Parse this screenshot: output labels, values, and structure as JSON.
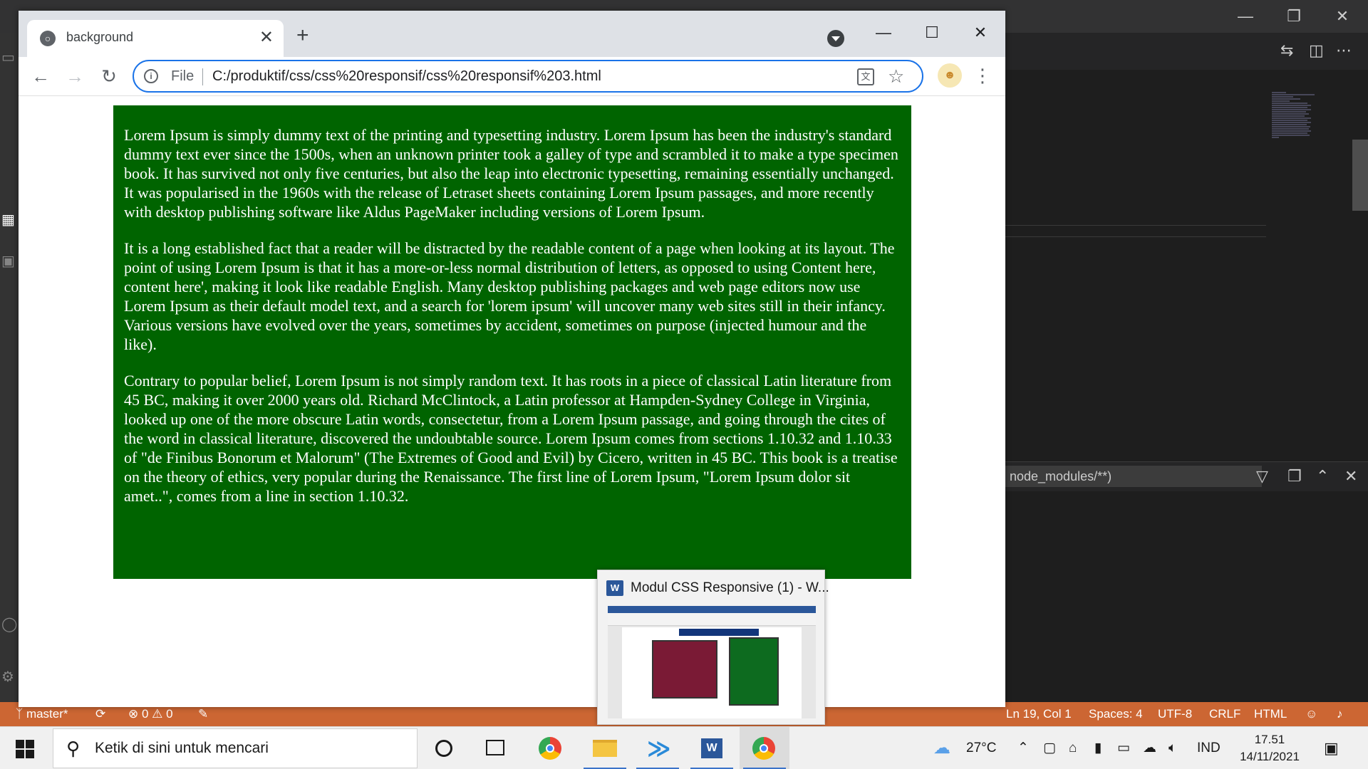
{
  "vscode": {
    "filter_text": "node_modules/**)",
    "status": {
      "branch": "master*",
      "errors": "0",
      "warnings": "0",
      "cursor": "Ln 19, Col 1",
      "spaces": "Spaces: 4",
      "encoding": "UTF-8",
      "eol": "CRLF",
      "language": "HTML"
    }
  },
  "chrome": {
    "tab_title": "background",
    "scheme_label": "File",
    "url": "C:/produktif/css/css%20responsif/css%20responsif%203.html"
  },
  "page": {
    "paragraphs": [
      "Lorem Ipsum is simply dummy text of the printing and typesetting industry. Lorem Ipsum has been the industry's standard dummy text ever since the 1500s, when an unknown printer took a galley of type and scrambled it to make a type specimen book. It has survived not only five centuries, but also the leap into electronic typesetting, remaining essentially unchanged. It was popularised in the 1960s with the release of Letraset sheets containing Lorem Ipsum passages, and more recently with desktop publishing software like Aldus PageMaker including versions of Lorem Ipsum.",
      "It is a long established fact that a reader will be distracted by the readable content of a page when looking at its layout. The point of using Lorem Ipsum is that it has a more-or-less normal distribution of letters, as opposed to using Content here, content here', making it look like readable English. Many desktop publishing packages and web page editors now use Lorem Ipsum as their default model text, and a search for 'lorem ipsum' will uncover many web sites still in their infancy. Various versions have evolved over the years, sometimes by accident, sometimes on purpose (injected humour and the like).",
      "Contrary to popular belief, Lorem Ipsum is not simply random text. It has roots in a piece of classical Latin literature from 45 BC, making it over 2000 years old. Richard McClintock, a Latin professor at Hampden-Sydney College in Virginia, looked up one of the more obscure Latin words, consectetur, from a Lorem Ipsum passage, and going through the cites of the word in classical literature, discovered the undoubtable source. Lorem Ipsum comes from sections 1.10.32 and 1.10.33 of \"de Finibus Bonorum et Malorum\" (The Extremes of Good and Evil) by Cicero, written in 45 BC. This book is a treatise on the theory of ethics, very popular during the Renaissance. The first line of Lorem Ipsum, \"Lorem Ipsum dolor sit amet..\", comes from a line in section 1.10.32."
    ]
  },
  "preview": {
    "title": "Modul CSS Responsive (1) - W..."
  },
  "taskbar": {
    "search_placeholder": "Ketik di sini untuk mencari",
    "weather": "27°C",
    "language": "IND",
    "time": "17.51",
    "date": "14/11/2021"
  },
  "colors": {
    "page_box": "#006400",
    "vscode_status": "#cc6633",
    "accent": "#1a73e8"
  }
}
